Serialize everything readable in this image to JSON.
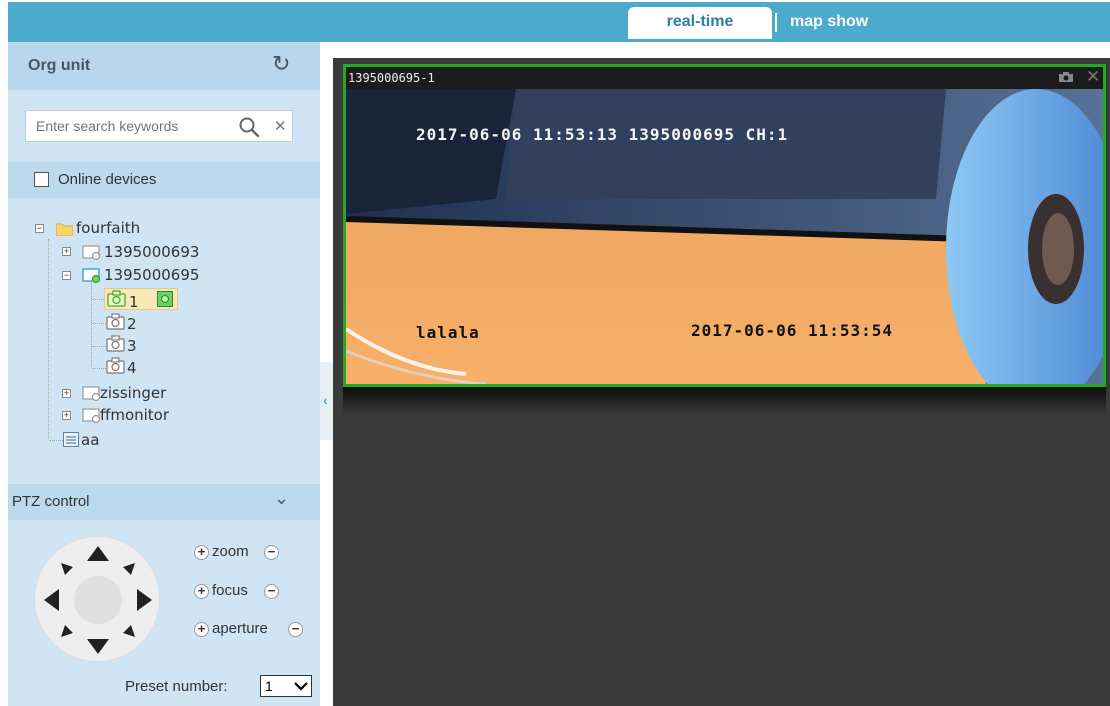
{
  "nav": {
    "tabs": [
      {
        "label": "real-time",
        "active": true
      },
      {
        "label": "map show",
        "active": false
      }
    ]
  },
  "org": {
    "title": "Org unit",
    "search_placeholder": "Enter search keywords",
    "online_label": "Online devices",
    "online_checked": false
  },
  "tree": {
    "root": "fourfaith",
    "devices": [
      {
        "name": "1395000693",
        "expanded": false,
        "online": false
      },
      {
        "name": "1395000695",
        "expanded": true,
        "online": true,
        "channels": [
          "1",
          "2",
          "3",
          "4"
        ]
      },
      {
        "name": "zissinger",
        "expanded": false,
        "online": false
      },
      {
        "name": "ffmonitor",
        "expanded": false,
        "online": false
      }
    ],
    "other": "aa"
  },
  "ptz": {
    "title": "PTZ control",
    "zoom_label": "zoom",
    "focus_label": "focus",
    "aperture_label": "aperture",
    "preset_label": "Preset number:",
    "preset_value": "1"
  },
  "video": {
    "title": "1395000695-1",
    "osd_top": "2017-06-06 11:53:13 1395000695 CH:1",
    "osd_left": "lalala",
    "osd_right": "2017-06-06 11:53:54"
  },
  "colors": {
    "topbar": "#4caacc",
    "panel": "#cfe5f4",
    "selected_border": "#22aa22",
    "content_bg": "#3a3a3a"
  }
}
